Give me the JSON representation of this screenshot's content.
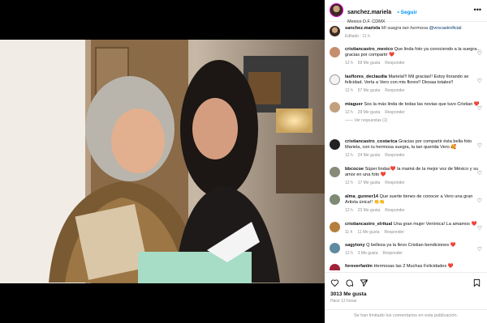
{
  "post": {
    "username": "sanchez.mariela",
    "location": "Mexico D.F. CDMX",
    "follow_label": "Seguir",
    "caption_text": "Mi suegra tan hermosa",
    "caption_mention": "@vrocastroficial",
    "caption_meta": "Editado · 11 h",
    "likes": "3013 Me gusta",
    "time_ago": "Hace 12 horas",
    "comments_disabled": "Se han limitado los comentarios en esta publicación."
  },
  "comments": [
    {
      "user": "cristiancastro_mexico",
      "text": "Que linda foto ya conociendo a la suegra... gracias por compartir ❤️",
      "time": "12 h",
      "likes": "59 Me gusta",
      "reply": "Responder"
    },
    {
      "user": "lasflores_declaudia",
      "text": "Mariela!!! Mil gracias!! Estoy llorando se felicidad. Verla a Vero con mis flores!! Diosaa totales!!",
      "time": "12 h",
      "likes": "57 Me gusta",
      "reply": "Responder"
    },
    {
      "user": "miaguer",
      "text": "Sos la más linda de todas las novias que tuvo Cristian ❤️",
      "time": "12 h",
      "likes": "29 Me gusta",
      "reply": "Responder",
      "replies": "Ver respuestas (1)"
    },
    {
      "user": "cristiancastro_costarica",
      "text": "Gracias por compartir ésta bella foto Mariela, con tu hermosa suegra, la tan querida Vero 🥰",
      "time": "12 h",
      "likes": "24 Me gusta",
      "reply": "Responder"
    },
    {
      "user": "bbcocoe",
      "text": "Súper lindas❤️ la mamá de la mejor voz de México y su amor en una foto ❤️",
      "time": "12 h",
      "likes": "17 Me gusta",
      "reply": "Responder"
    },
    {
      "user": "alma_gunner14",
      "text": "Que suerte tienes de conocer a Vero una gran Artista única!! 👏👏",
      "time": "12 h",
      "likes": "23 Me gusta",
      "reply": "Responder"
    },
    {
      "user": "cristiancastro_elritual",
      "text": "Una gran mujer Verónica! La amamos ❤️",
      "time": "11 h",
      "likes": "11 Me gusta",
      "reply": "Responder"
    },
    {
      "user": "sagytony",
      "text": "Q belleza ya la llevo Cristian bendiciones ❤️",
      "time": "12 h",
      "likes": "3 Me gusta",
      "reply": "Responder"
    },
    {
      "user": "foreverfanlm",
      "text": "Hermosas las 2 Muchas Felicidades ❤️",
      "time": "",
      "likes": "",
      "reply": ""
    }
  ],
  "icons": [
    "more-icon",
    "heart-icon",
    "comment-icon",
    "share-icon",
    "bookmark-icon"
  ],
  "colors": {
    "link": "#0095f6",
    "meta": "#8e8e8e",
    "heart_red": "#ed4956"
  }
}
